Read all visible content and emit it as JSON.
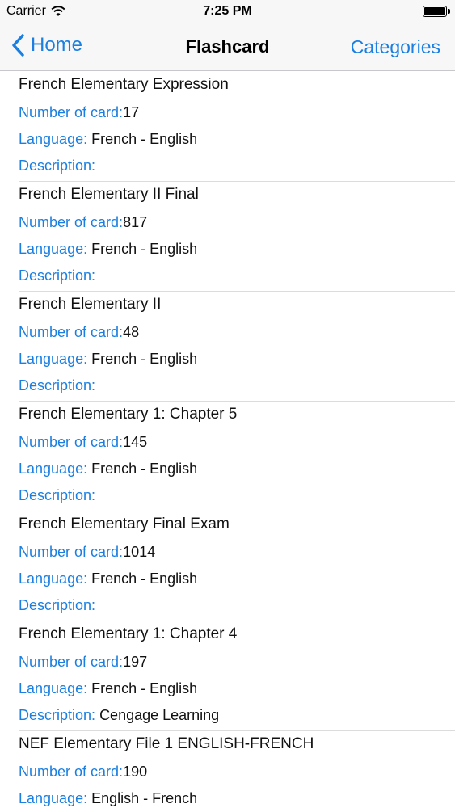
{
  "status": {
    "carrier": "Carrier",
    "time": "7:25 PM",
    "battery_level": 1.0
  },
  "nav": {
    "back_label": "Home",
    "title": "Flashcard",
    "right_label": "Categories"
  },
  "labels": {
    "count": "Number of card:",
    "language": "Language:",
    "description": "Description:"
  },
  "items": [
    {
      "title": "French Elementary Expression",
      "count": "17",
      "language": "French - English",
      "description": ""
    },
    {
      "title": "French Elementary II Final",
      "count": "817",
      "language": "French - English",
      "description": ""
    },
    {
      "title": "French Elementary II",
      "count": "48",
      "language": "French - English",
      "description": ""
    },
    {
      "title": "French Elementary 1: Chapter 5",
      "count": "145",
      "language": "French - English",
      "description": ""
    },
    {
      "title": "French Elementary Final Exam",
      "count": "1014",
      "language": "French - English",
      "description": ""
    },
    {
      "title": "French Elementary 1: Chapter 4",
      "count": "197",
      "language": "French - English",
      "description": "Cengage Learning"
    },
    {
      "title": "NEF Elementary File 1 ENGLISH-FRENCH",
      "count": "190",
      "language": "English - French",
      "description": ""
    }
  ]
}
